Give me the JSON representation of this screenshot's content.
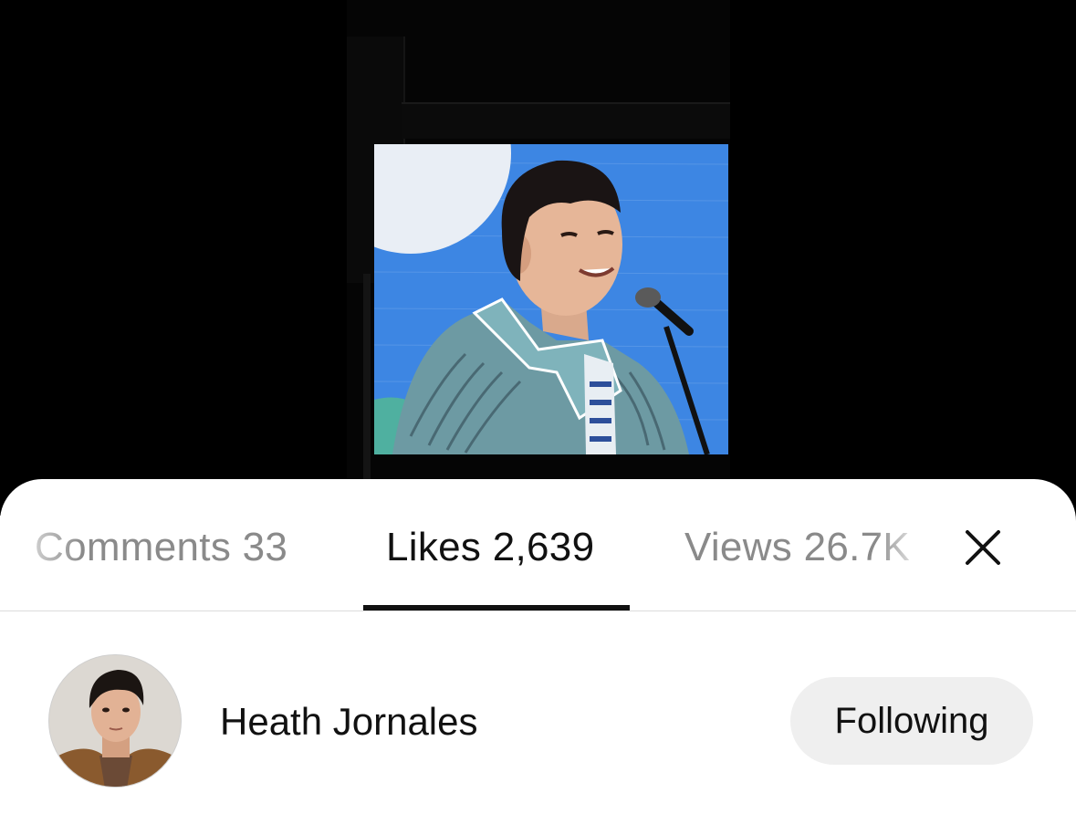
{
  "media": {
    "description_icon": "photo"
  },
  "tabs": [
    {
      "label": "Comments 33",
      "active": false
    },
    {
      "label": "Likes 2,639",
      "active": true
    },
    {
      "label": "Views 26.7K",
      "active": false
    }
  ],
  "close_icon": "close-icon",
  "user": {
    "name": "Heath Jornales",
    "follow_label": "Following"
  },
  "colors": {
    "sheet_bg": "#ffffff",
    "active_tab": "#111111",
    "inactive_tab": "#8a8a8a",
    "follow_button_bg": "#efefef",
    "screen_blue": "#3d86e3"
  }
}
